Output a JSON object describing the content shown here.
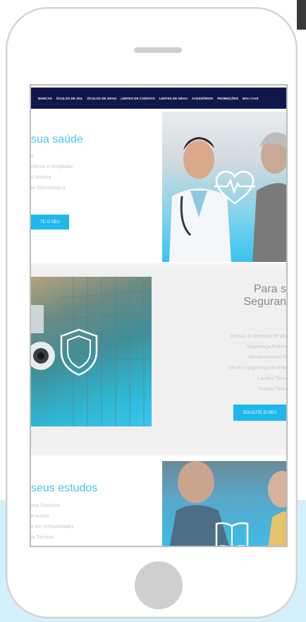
{
  "nav": {
    "items": [
      "MARCAS",
      "ÓCULOS DE SOL",
      "ÓCULOS DE GRAU",
      "LENTES DE CONTATO",
      "LENTES DE GRAU",
      "ACESSÓRIOS",
      "PROMOÇÕES",
      "BALI Cred"
    ]
  },
  "section1": {
    "heading": "sua saúde",
    "lines": [
      "s",
      "édicos e Hospitalar",
      "",
      "o Médica",
      "la Odontológica"
    ],
    "button": "TE O SEU"
  },
  "section2": {
    "heading_line1": "Para s",
    "heading_line2": "Seguran",
    "lines": [
      "Acesso à sistemas de ala",
      "Segurança Patrim",
      "Monitoramento E",
      "Técnico segurança do trab",
      "Laudos Técn",
      "Cursos Técn"
    ],
    "button": "SOLICITE O SEU"
  },
  "section3": {
    "heading": "seus estudos",
    "lines": [
      "dos Gratuitos",
      "Estudos",
      "e em mensalidades",
      "la Técnica"
    ]
  },
  "colors": {
    "accent": "#1eb7ec",
    "heading": "#47c8ef",
    "nav_bg": "#10174a",
    "outer_bg": "#d4f1fb"
  },
  "icons": [
    "heart-pulse-icon",
    "shield-icon",
    "book-icon"
  ]
}
